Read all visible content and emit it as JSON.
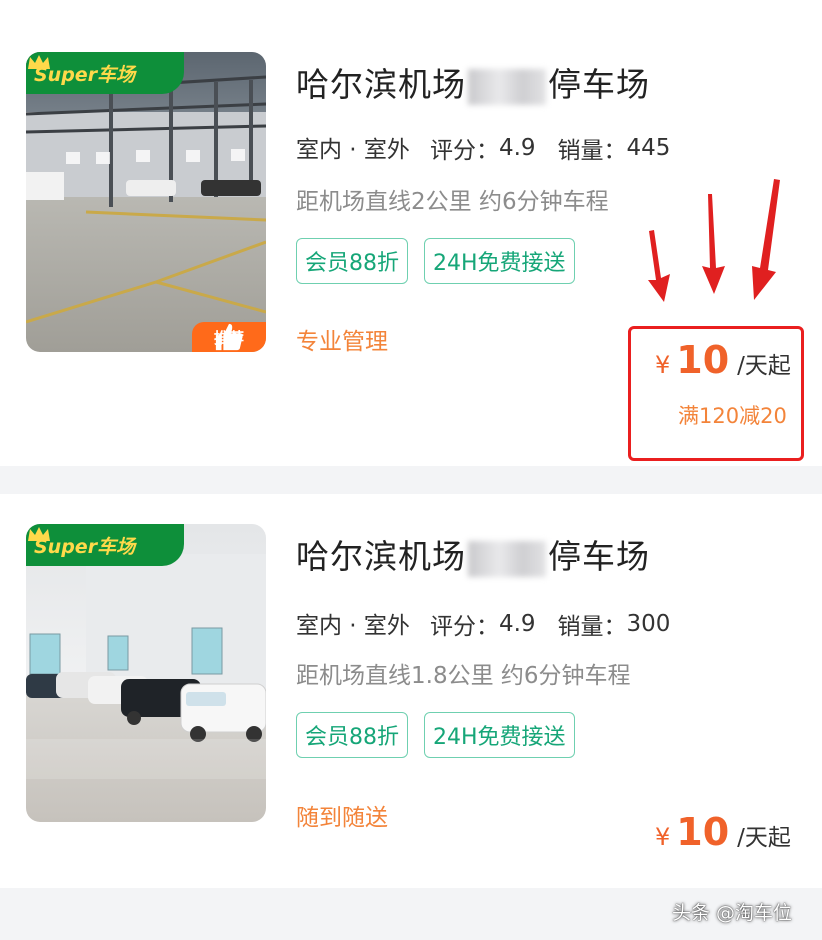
{
  "listings": [
    {
      "brand": "Super车场",
      "recommend": "推荐",
      "title_prefix": "哈尔滨机场",
      "title_suffix": "停车场",
      "type": "室内 · 室外",
      "rating_label": "评分：",
      "rating": "4.9",
      "sales_label": "销量：",
      "sales": "445",
      "distance": "距机场直线2公里 约6分钟车程",
      "tags": [
        "会员88折",
        "24H免费接送"
      ],
      "extra": "专业管理",
      "price_symbol": "¥",
      "price": "10",
      "price_unit": "/天起",
      "discount": "满120减20"
    },
    {
      "brand": "Super车场",
      "title_prefix": "哈尔滨机场",
      "title_suffix": "停车场",
      "type": "室内 · 室外",
      "rating_label": "评分：",
      "rating": "4.9",
      "sales_label": "销量：",
      "sales": "300",
      "distance": "距机场直线1.8公里 约6分钟车程",
      "tags": [
        "会员88折",
        "24H免费接送"
      ],
      "extra": "随到随送",
      "price_symbol": "¥",
      "price": "10",
      "price_unit": "/天起"
    }
  ],
  "watermark": "头条 @淘车位",
  "colors": {
    "brand_green": "#0e8f3a",
    "brand_yellow": "#ffd94a",
    "tag_green": "#16a678",
    "price_orange": "#f0622a",
    "highlight_red": "#ea1f1f"
  },
  "icons": [
    "crown-icon",
    "thumbs-up-icon",
    "red-arrow-icon"
  ]
}
